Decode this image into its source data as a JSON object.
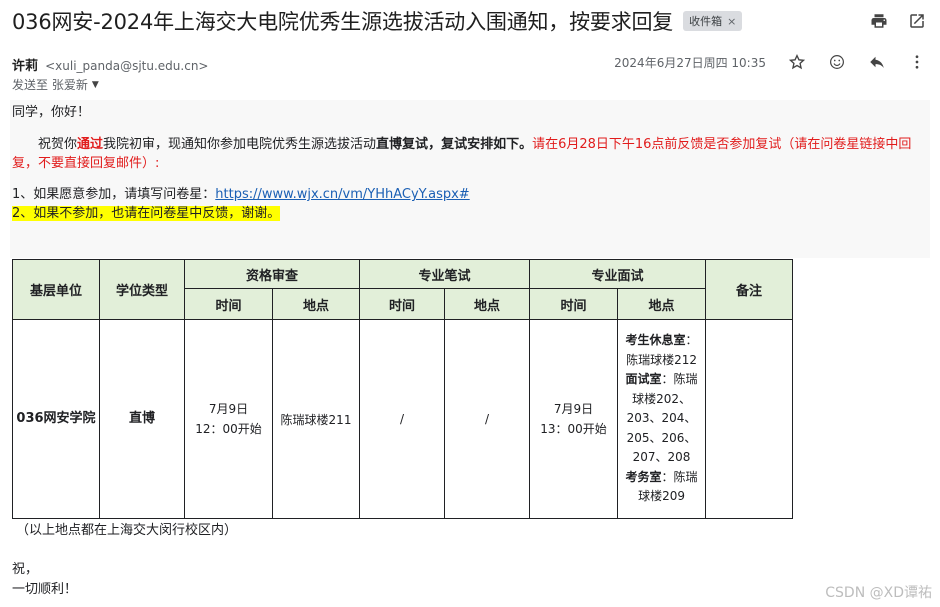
{
  "subject": "036网安-2024年上海交大电院优秀生源选拔活动入围通知，按要求回复",
  "label_chip": "收件箱",
  "label_chip_remove": "×",
  "top_actions": [
    {
      "icon": "print-icon"
    },
    {
      "icon": "open-in-new-window-icon"
    }
  ],
  "sender": {
    "name": "许莉",
    "email": "<xuli_panda@sjtu.edu.cn>",
    "timestamp": "2024年6月27日周四 10:35",
    "to": "发送至 张爱新"
  },
  "sender_actions": [
    {
      "icon": "star-icon"
    },
    {
      "icon": "emoji-icon"
    },
    {
      "icon": "reply-icon"
    },
    {
      "icon": "more-vert-icon"
    }
  ],
  "body": {
    "greeting": "同学，你好！",
    "p2_a": "祝贺你",
    "p2_b": "通过",
    "p2_c": "我院初审，现通知你参加电院优秀生源选拔活动",
    "p2_d": "直博复试",
    "p2_e": "，复试安排如下。",
    "p2_f": "请在6月28日下午16点前反馈是否参加复试（请在问卷星链接中回复，不要直接回复邮件）:",
    "p3_prefix": "1、如果愿意参加，请填写问卷星：",
    "p3_link": "https://www.wjx.cn/vm/YHhACyY.aspx#",
    "p4": "2、如果不参加，也请在问卷星中反馈，谢谢。"
  },
  "table": {
    "headers": {
      "unit": "基层单位",
      "degree": "学位类型",
      "qual": "资格审查",
      "written": "专业笔试",
      "interview": "专业面试",
      "remark": "备注",
      "time": "时间",
      "place": "地点"
    },
    "row": {
      "unit": "036网安学院",
      "degree": "直博",
      "qual_time_1": "7月9日",
      "qual_time_2": "12：00开始",
      "qual_place": "陈瑞球楼211",
      "written_time": "/",
      "written_place": "/",
      "interview_time_1": "7月9日",
      "interview_time_2": "13：00开始",
      "loc_1_head": "考生休息室",
      "loc_1_body": "：陈瑞球楼212",
      "loc_2_head": "面试室",
      "loc_2_body": "：陈瑞球楼202、203、204、205、206、207、208",
      "loc_3_head": "考务室",
      "loc_3_body": "：陈瑞球楼209",
      "remark": ""
    }
  },
  "note": "（以上地点都在上海交大闵行校区内）",
  "closing_1": "祝，",
  "closing_2": "一切顺利！",
  "watermark": "CSDN @XD谭祐",
  "colors": {
    "header_bg": "#e2efd9",
    "highlight": "#ffff00",
    "red_text": "#e11c1c",
    "link": "#1a5fb4"
  }
}
